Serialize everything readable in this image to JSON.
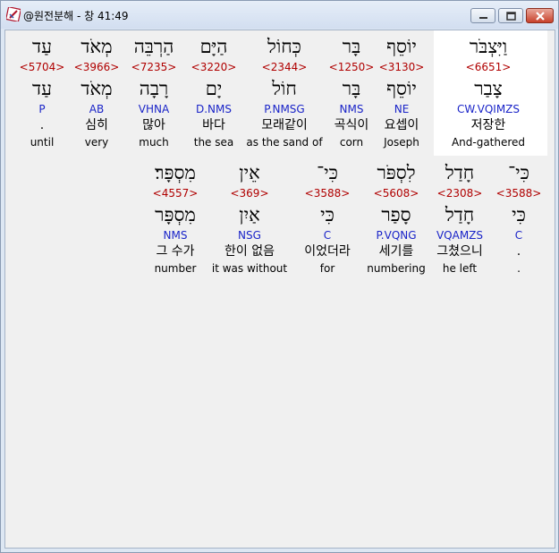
{
  "window": {
    "title": "@원전분해 - 창 41:49",
    "controls": [
      "minimize-icon",
      "maximize-icon",
      "close-icon"
    ]
  },
  "rows": [
    [
      {
        "heb": "וַיִּצְבֹּר",
        "strong": "<6651>",
        "lemma": "צָבַר",
        "parse": "CW.VQIMZS",
        "kor": "저장한",
        "eng": "And-gathered",
        "highlight": true
      },
      {
        "heb": "יוֹסֵף",
        "strong": "<3130>",
        "lemma": "יוֹסֵף",
        "parse": "NE",
        "kor": "요셉이",
        "eng": "Joseph"
      },
      {
        "heb": "בָּר",
        "strong": "<1250>",
        "lemma": "בָּר",
        "parse": "NMS",
        "kor": "곡식이",
        "eng": "corn"
      },
      {
        "heb": "כְּחוֹל",
        "strong": "<2344>",
        "lemma": "חוֹל",
        "parse": "P.NMSG",
        "kor": "모래같이",
        "eng": "as the sand of"
      },
      {
        "heb": "הַיָּם",
        "strong": "<3220>",
        "lemma": "יָם",
        "parse": "D.NMS",
        "kor": "바다",
        "eng": "the sea"
      },
      {
        "heb": "הַרְבֵּה",
        "strong": "<7235>",
        "lemma": "רָבָה",
        "parse": "VHNA",
        "kor": "많아",
        "eng": "much"
      },
      {
        "heb": "מְאֹד",
        "strong": "<3966>",
        "lemma": "מְאֹד",
        "parse": "AB",
        "kor": "심히",
        "eng": "very"
      },
      {
        "heb": "עַד",
        "strong": "<5704>",
        "lemma": "עַד",
        "parse": "P",
        "kor": ".",
        "eng": "until"
      }
    ],
    [
      {
        "heb": "כִּי־",
        "strong": "<3588>",
        "lemma": "כִּי",
        "parse": "C",
        "kor": ".",
        "eng": "."
      },
      {
        "heb": "חָדַל",
        "strong": "<2308>",
        "lemma": "חָדַל",
        "parse": "VQAMZS",
        "kor": "그쳤으니",
        "eng": "he left"
      },
      {
        "heb": "לִסְפֹּר",
        "strong": "<5608>",
        "lemma": "סָפַר",
        "parse": "P.VQNG",
        "kor": "세기를",
        "eng": "numbering"
      },
      {
        "heb": "כִּי־",
        "strong": "<3588>",
        "lemma": "כִּי",
        "parse": "C",
        "kor": "이었더라",
        "eng": "for"
      },
      {
        "heb": "אֵין",
        "strong": "<369>",
        "lemma": "אַיִן",
        "parse": "NSG",
        "kor": "한이 없음",
        "eng": "it was without"
      },
      {
        "heb": "מִסְפָּר׃",
        "strong": "<4557>",
        "lemma": "מִסְפָּר",
        "parse": "NMS",
        "kor": "그 수가",
        "eng": "number"
      }
    ]
  ]
}
